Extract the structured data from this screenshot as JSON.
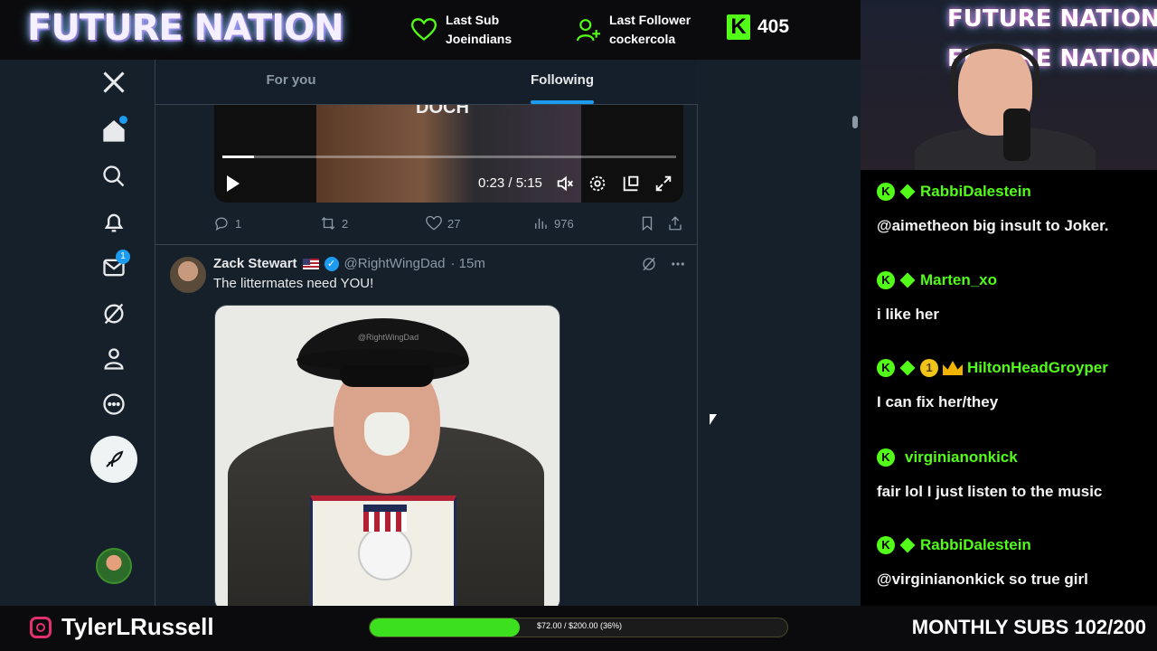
{
  "overlay": {
    "brand": "FUTURE NATION",
    "last_sub": {
      "title": "Last Sub",
      "value": "Joeindians"
    },
    "last_follower": {
      "title": "Last Follower",
      "value": "cockercola"
    },
    "kick": {
      "badge": "K",
      "count": "405"
    },
    "instagram_handle": "TylerLRussell",
    "goal": {
      "text": "$72.00 / $200.00 (36%)",
      "fraction": 0.36
    },
    "monthly_subs": "MONTHLY SUBS 102/200",
    "colors": {
      "kick_green": "#53fc18",
      "x_blue": "#1d9bf0",
      "x_bg": "#15202b"
    }
  },
  "x": {
    "nav": {
      "icons": [
        "x-logo-icon",
        "home-icon",
        "search-icon",
        "bell-icon",
        "mail-icon",
        "grok-icon",
        "profile-icon",
        "more-icon",
        "post-icon"
      ],
      "messages_badge": "1"
    },
    "tabs": [
      {
        "label": "For you",
        "active": false
      },
      {
        "label": "Following",
        "active": true
      }
    ],
    "video": {
      "time": "0:23 / 5:15",
      "progress": 0.07
    },
    "prev_post_actions": {
      "replies": "1",
      "reposts": "2",
      "likes": "27",
      "views": "976"
    },
    "tweet": {
      "name": "Zack Stewart",
      "handle": "@RightWingDad",
      "time": "· 15m",
      "text": "The littermates need YOU!",
      "media_watermark": "@RightWingDad"
    }
  },
  "webcam": {
    "neon_text": "FUTURE NATION"
  },
  "chat": {
    "messages": [
      {
        "user": "RabbiDalestein",
        "text": "@aimetheon big insult to Joker."
      },
      {
        "user": "Marten_xo",
        "text": "i like her"
      },
      {
        "user": "HiltonHeadGroyper",
        "badge_number": "1",
        "text": "I can fix her/they"
      },
      {
        "user": "virginianonkick",
        "text": "fair lol I just listen to the music"
      },
      {
        "user": "RabbiDalestein",
        "text": "@virginianonkick so true girl"
      }
    ]
  }
}
